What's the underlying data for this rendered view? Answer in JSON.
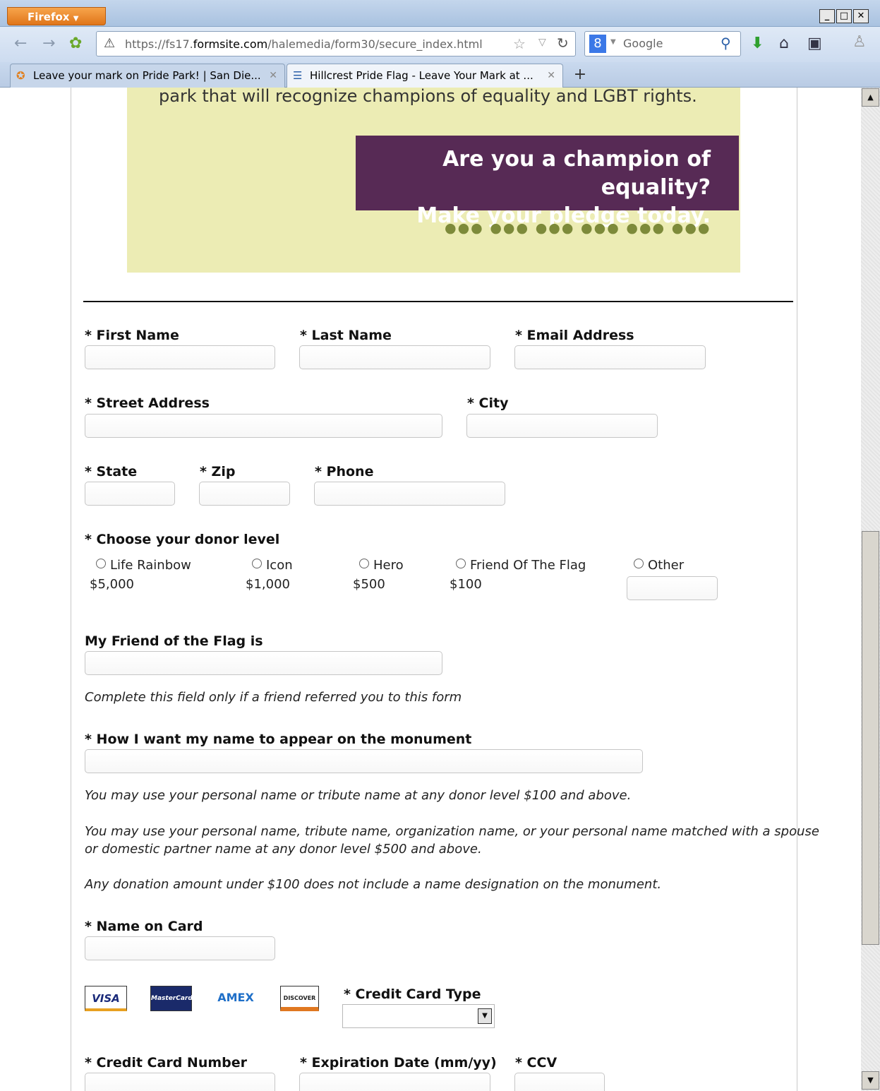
{
  "browser": {
    "app_button": "Firefox",
    "url_prefix": "https://fs17.",
    "url_domain": "formsite.com",
    "url_path": "/halemedia/form30/secure_index.html",
    "search_engine": "Google",
    "tabs": [
      {
        "label": "Leave your mark on Pride Park! | San Die..."
      },
      {
        "label": "Hillcrest Pride Flag - Leave Your Mark at ..."
      }
    ]
  },
  "banner": {
    "text": "park that will recognize champions of equality and LGBT rights.",
    "cta_line1": "Are you a champion of equality?",
    "cta_line2": "Make your pledge today.",
    "dots": "●●●  ●●●  ●●●  ●●●  ●●●  ●●●"
  },
  "form": {
    "first_name_label": "* First Name",
    "last_name_label": "* Last Name",
    "email_label": "* Email Address",
    "street_label": "* Street Address",
    "city_label": "* City",
    "state_label": "* State",
    "zip_label": "* Zip",
    "phone_label": "* Phone",
    "donor_label": "* Choose your donor level",
    "donor_levels": [
      {
        "label": "Life Rainbow",
        "amount": "$5,000"
      },
      {
        "label": "Icon",
        "amount": "$1,000"
      },
      {
        "label": "Hero",
        "amount": "$500"
      },
      {
        "label": "Friend Of The Flag",
        "amount": "$100"
      },
      {
        "label": "Other",
        "amount": ""
      }
    ],
    "friend_label": "My Friend of the Flag is",
    "friend_note": "Complete this field only if a friend referred you to this form",
    "monument_label": "* How I want my name to appear on the monument",
    "monument_note1": "You may use your personal name or tribute name at any donor level $100 and above.",
    "monument_note2a": "You may use your personal name, tribute name, organization name, or your personal name matched with a spouse",
    "monument_note2b": "or domestic partner name at any donor level $500 and above.",
    "monument_note3": "Any donation amount under $100 does not include a name designation on the monument.",
    "name_on_card_label": "* Name on Card",
    "card_logos": [
      "VISA",
      "MasterCard",
      "AMEX",
      "DISCOVER"
    ],
    "card_type_label": "* Credit Card Type",
    "card_number_label": "* Credit Card Number",
    "expiration_label": "* Expiration Date (mm/yy)",
    "ccv_label": "* CCV"
  },
  "colors": {
    "banner_bg": "#ececb4",
    "cta_bg": "#572a55",
    "dots": "#7d8a3a"
  }
}
